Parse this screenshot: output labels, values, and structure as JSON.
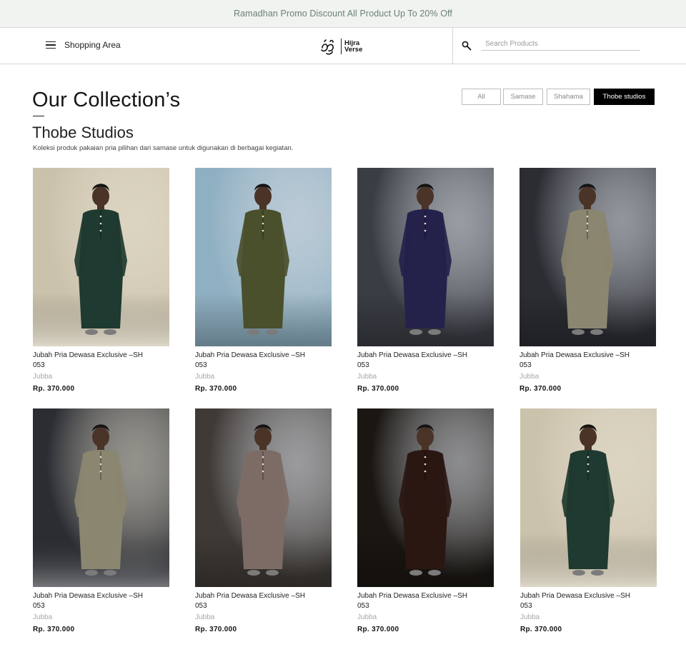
{
  "promo": {
    "text": "Ramadhan Promo Discount All Product Up To 20% Off"
  },
  "header": {
    "menu_icon": "hamburger-menu-icon",
    "menu_label": "Shopping Area",
    "logo": {
      "line1": "Hijra",
      "line2": "Verse"
    },
    "search": {
      "icon": "search-icon",
      "placeholder": "Search Products",
      "value": ""
    }
  },
  "collection": {
    "title": "Our Collection’s",
    "subtitle": "Thobe Studios",
    "description": "Koleksi produk pakaian pria pilihan dari  samase untuk digunakan di berbagai kegiatan."
  },
  "filters": [
    {
      "label": "All",
      "active": false
    },
    {
      "label": "Samase",
      "active": false
    },
    {
      "label": "Shahama",
      "active": false
    },
    {
      "label": "Thobe studios",
      "active": true
    }
  ],
  "products": [
    {
      "name": "Jubah Pria Dewasa Exclusive –SH\n053",
      "category": "Jubba",
      "price": "Rp. 370.000",
      "robe_color": "#1f3a30",
      "bg_color": "#cbc2ac"
    },
    {
      "name": "Jubah Pria Dewasa Exclusive –SH\n053",
      "category": "Jubba",
      "price": "Rp. 370.000",
      "robe_color": "#4a4f2c",
      "bg_color": "#8fb0c2"
    },
    {
      "name": "Jubah Pria Dewasa Exclusive –SH\n053",
      "category": "Jubba",
      "price": "Rp. 370.000",
      "robe_color": "#24224a",
      "bg_color": "#3a3d44"
    },
    {
      "name": "Jubah Pria Dewasa Exclusive –SH\n053",
      "category": "Jubba",
      "price": "Rp. 370.000",
      "robe_color": "#8b8670",
      "bg_color": "#2b2d33"
    },
    {
      "name": "Jubah Pria Dewasa Exclusive –SH\n053",
      "category": "Jubba",
      "price": "Rp. 370.000",
      "robe_color": "#8b8670",
      "bg_color": "#2b2d33"
    },
    {
      "name": "Jubah Pria Dewasa Exclusive –SH\n053",
      "category": "Jubba",
      "price": "Rp. 370.000",
      "robe_color": "#7d6c66",
      "bg_color": "#3f3a36"
    },
    {
      "name": "Jubah Pria Dewasa Exclusive –SH\n053",
      "category": "Jubba",
      "price": "Rp. 370.000",
      "robe_color": "#2a1712",
      "bg_color": "#1a1612"
    },
    {
      "name": "Jubah Pria Dewasa Exclusive –SH\n053",
      "category": "Jubba",
      "price": "Rp. 370.000",
      "robe_color": "#1f3a30",
      "bg_color": "#cbc2ac"
    }
  ]
}
